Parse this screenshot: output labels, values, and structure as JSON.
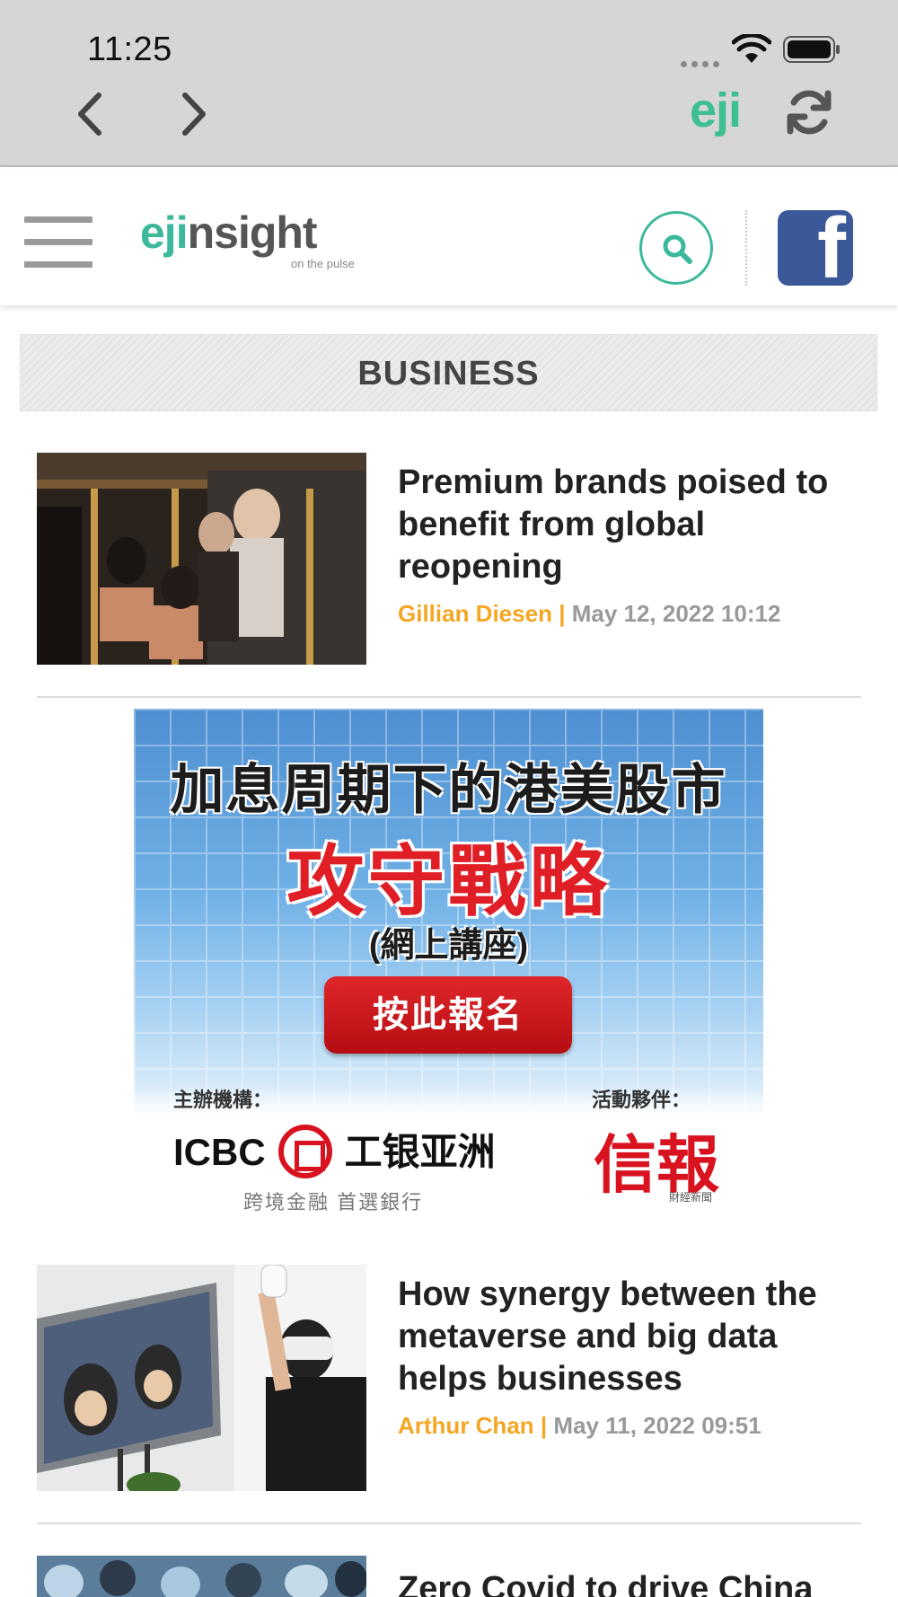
{
  "status_bar": {
    "time": "11:25"
  },
  "browser": {
    "app_logo": "eji"
  },
  "site": {
    "logo_prefix": "eji",
    "logo_suffix": "nsight",
    "logo_tagline": "on the pulse"
  },
  "section": {
    "title": "BUSINESS"
  },
  "articles": [
    {
      "headline": "Premium brands poised to benefit from global reopening",
      "author": "Gillian Diesen",
      "separator": "|",
      "date": "May 12, 2022 10:12"
    },
    {
      "headline": "How synergy between the metaverse and big data helps businesses",
      "author": "Arthur Chan",
      "separator": "|",
      "date": "May 11, 2022 09:51"
    },
    {
      "headline": "Zero Covid to drive China"
    }
  ],
  "ad": {
    "line1": "加息周期下的港美股市",
    "line2": "攻守戰略",
    "line3": "(網上講座)",
    "cta": "按此報名",
    "organizer_label": "主辦機構：",
    "partner_label": "活動夥伴：",
    "organizer_name_en": "ICBC",
    "organizer_name_cn": "工银亚洲",
    "organizer_tagline": "跨境金融 首選銀行",
    "partner_name": "信報",
    "partner_sub": "財經新聞"
  },
  "colors": {
    "accent_green": "#3cb89b",
    "author_orange": "#f5a623",
    "facebook_blue": "#3b5998",
    "ad_red": "#e01e26"
  }
}
